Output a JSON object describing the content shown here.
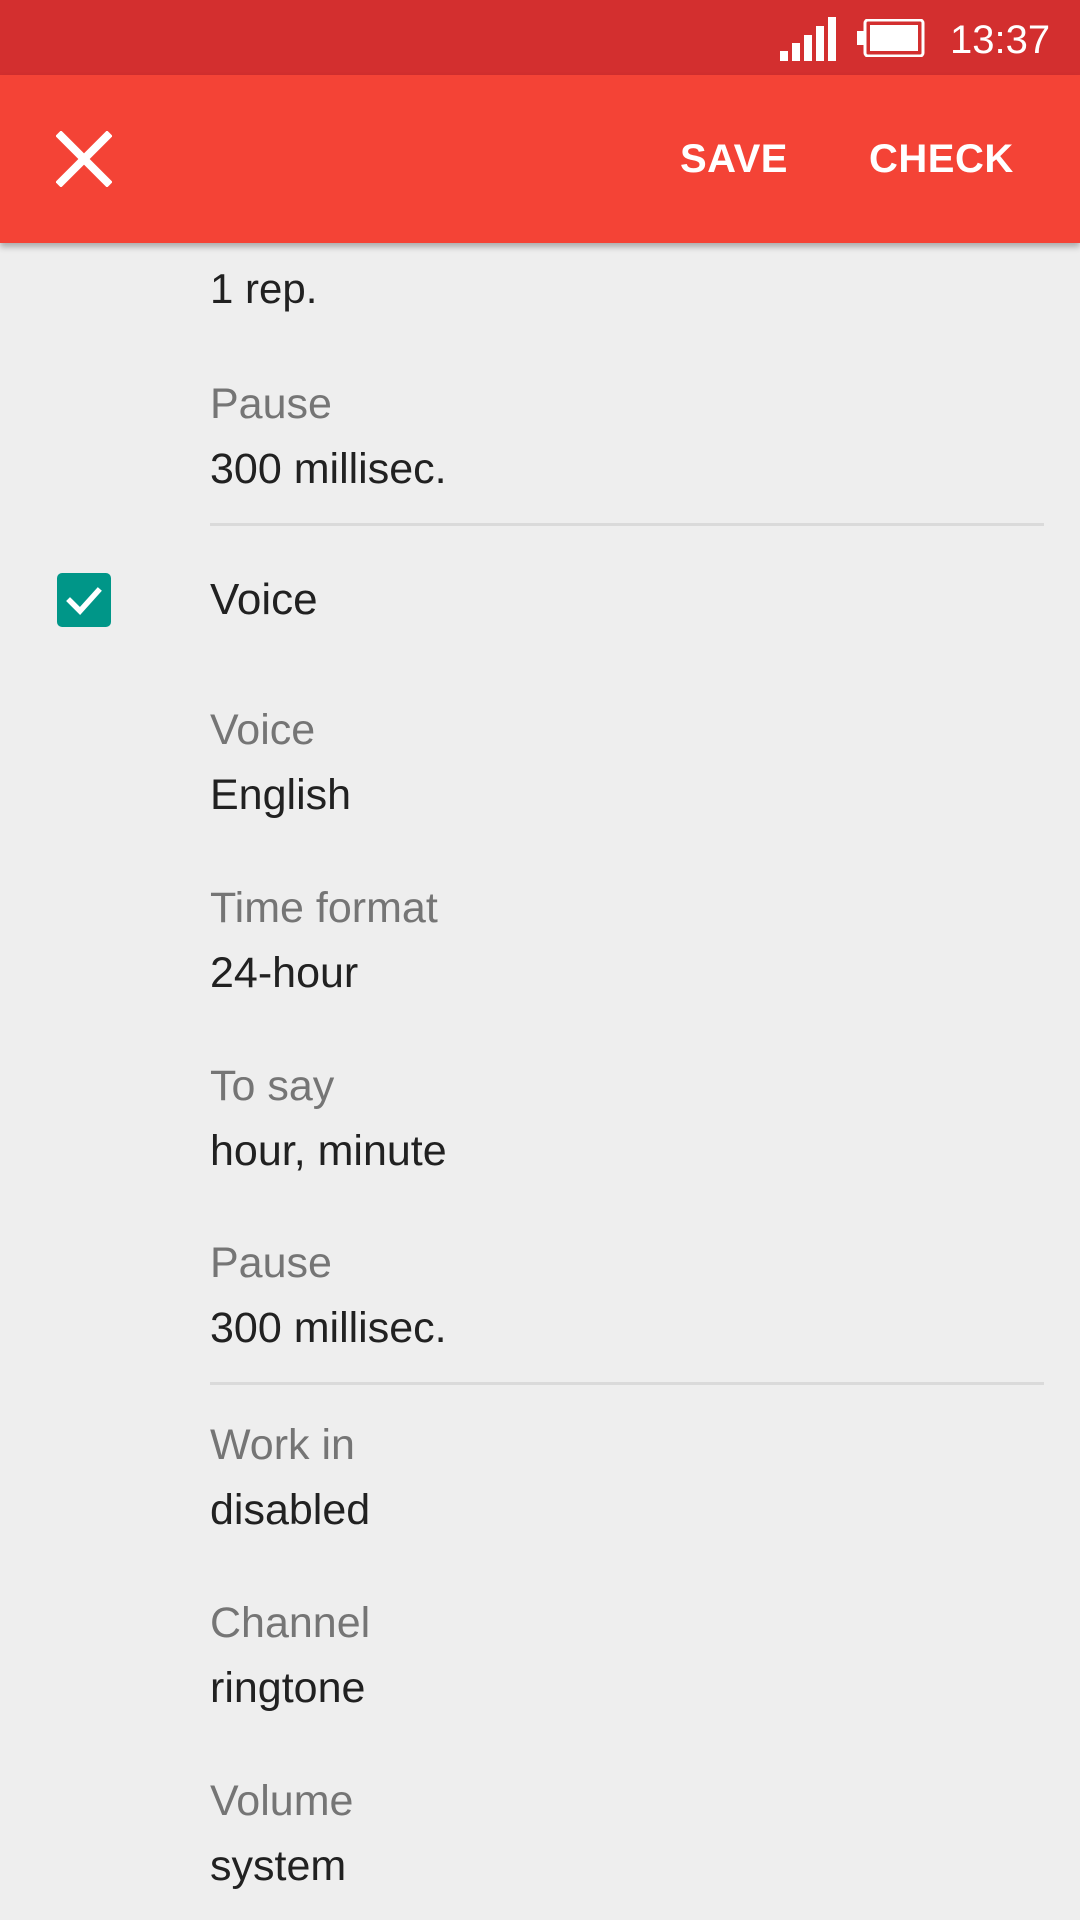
{
  "status_bar": {
    "time": "13:37",
    "signal_icon": "cell-signal-icon",
    "battery_icon": "battery-icon",
    "background": "#d32f2f"
  },
  "app_bar": {
    "close_icon": "close-icon",
    "save_label": "SAVE",
    "check_label": "CHECK",
    "background": "#f44336"
  },
  "content": {
    "partial_top_value": "1 rep.",
    "beep_pause": {
      "title": "Pause",
      "value": "300 millisec."
    },
    "voice_toggle": {
      "label": "Voice",
      "checked": true,
      "accent": "#009688"
    },
    "voice": {
      "title": "Voice",
      "value": "English"
    },
    "time_format": {
      "title": "Time format",
      "value": "24-hour"
    },
    "to_say": {
      "title": "To say",
      "value": "hour, minute"
    },
    "voice_pause": {
      "title": "Pause",
      "value": "300 millisec."
    },
    "work_in": {
      "title": "Work in",
      "value": "disabled"
    },
    "channel": {
      "title": "Channel",
      "value": "ringtone"
    },
    "volume": {
      "title": "Volume",
      "value": "system"
    }
  }
}
